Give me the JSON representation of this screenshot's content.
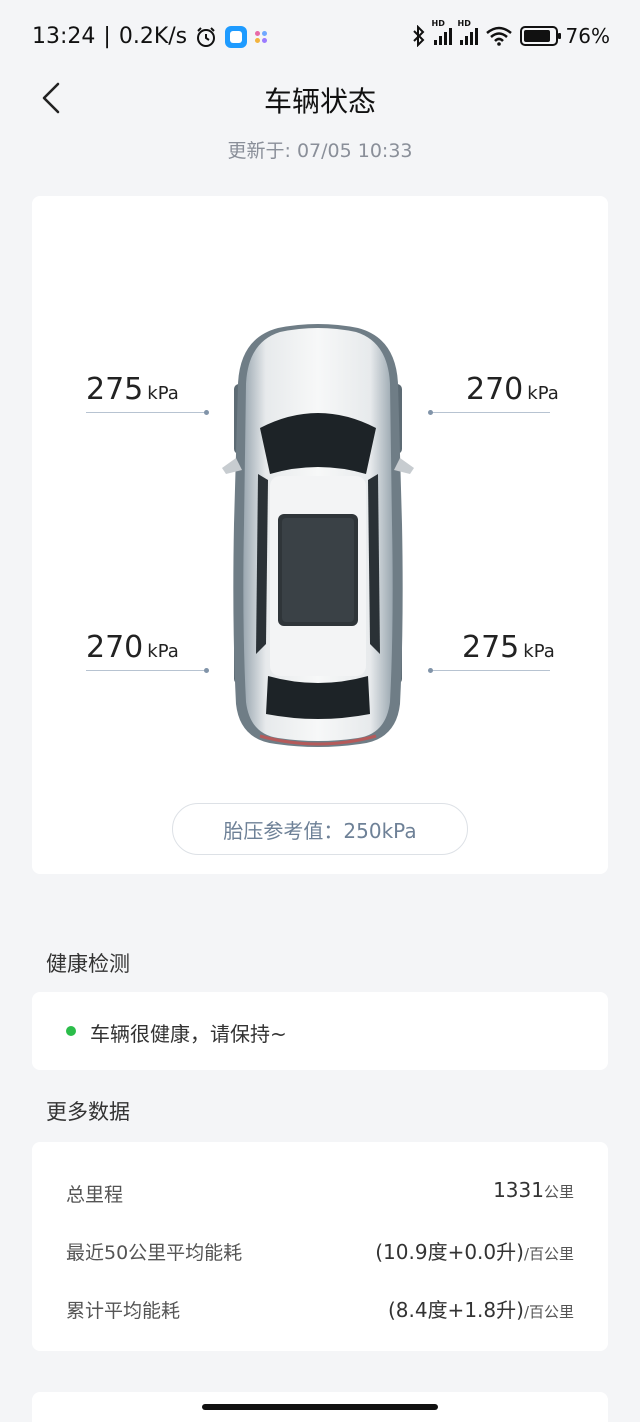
{
  "status_bar": {
    "time": "13:24",
    "net_speed": "0.2K/s",
    "battery": "76%"
  },
  "header": {
    "title": "车辆状态",
    "updated": "更新于: 07/05 10:33"
  },
  "tires": {
    "front_left": {
      "value": "275",
      "unit": "kPa"
    },
    "front_right": {
      "value": "270",
      "unit": "kPa"
    },
    "rear_left": {
      "value": "270",
      "unit": "kPa"
    },
    "rear_right": {
      "value": "275",
      "unit": "kPa"
    },
    "reference": "胎压参考值：250kPa"
  },
  "health": {
    "section_title": "健康检测",
    "message": "车辆很健康，请保持~"
  },
  "more_data": {
    "section_title": "更多数据",
    "rows": [
      {
        "label": "总里程",
        "value": "1331",
        "unit": "公里"
      },
      {
        "label": "最近50公里平均能耗",
        "value": "(10.9度+0.0升)",
        "unit": "/百公里"
      },
      {
        "label": "累计平均能耗",
        "value": "(8.4度+1.8升)",
        "unit": "/百公里"
      }
    ]
  },
  "colors": {
    "accent_text": "#6e8197",
    "healthy": "#2bbd4a",
    "background": "#f4f5f7"
  }
}
